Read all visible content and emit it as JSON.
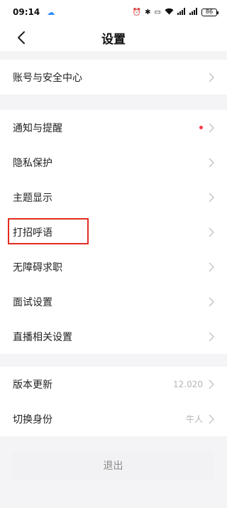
{
  "status_bar": {
    "time": "09:14",
    "cloud_icon": "cloud-icon",
    "battery": "86",
    "right_icons": [
      "alarm-icon",
      "bluetooth-icon",
      "nfc-icon",
      "wifi-icon",
      "signal-icon",
      "signal-icon"
    ]
  },
  "nav": {
    "title": "设置",
    "back_icon": "chevron-left-icon"
  },
  "groups": [
    {
      "items": [
        {
          "label": "账号与安全中心"
        }
      ]
    },
    {
      "items": [
        {
          "label": "通知与提醒",
          "dot": true
        },
        {
          "label": "隐私保护"
        },
        {
          "label": "主题显示"
        },
        {
          "label": "打招呼语"
        },
        {
          "label": "无障碍求职"
        },
        {
          "label": "面试设置"
        },
        {
          "label": "直播相关设置"
        }
      ]
    },
    {
      "items": [
        {
          "label": "版本更新",
          "value": "12.020"
        },
        {
          "label": "切换身份",
          "value": "牛人"
        }
      ]
    }
  ],
  "logout": {
    "label": "退出"
  },
  "colors": {
    "accent_red": "#e22b22",
    "dot_red": "#ff3b47",
    "gap_bg": "#f4f4f6"
  }
}
